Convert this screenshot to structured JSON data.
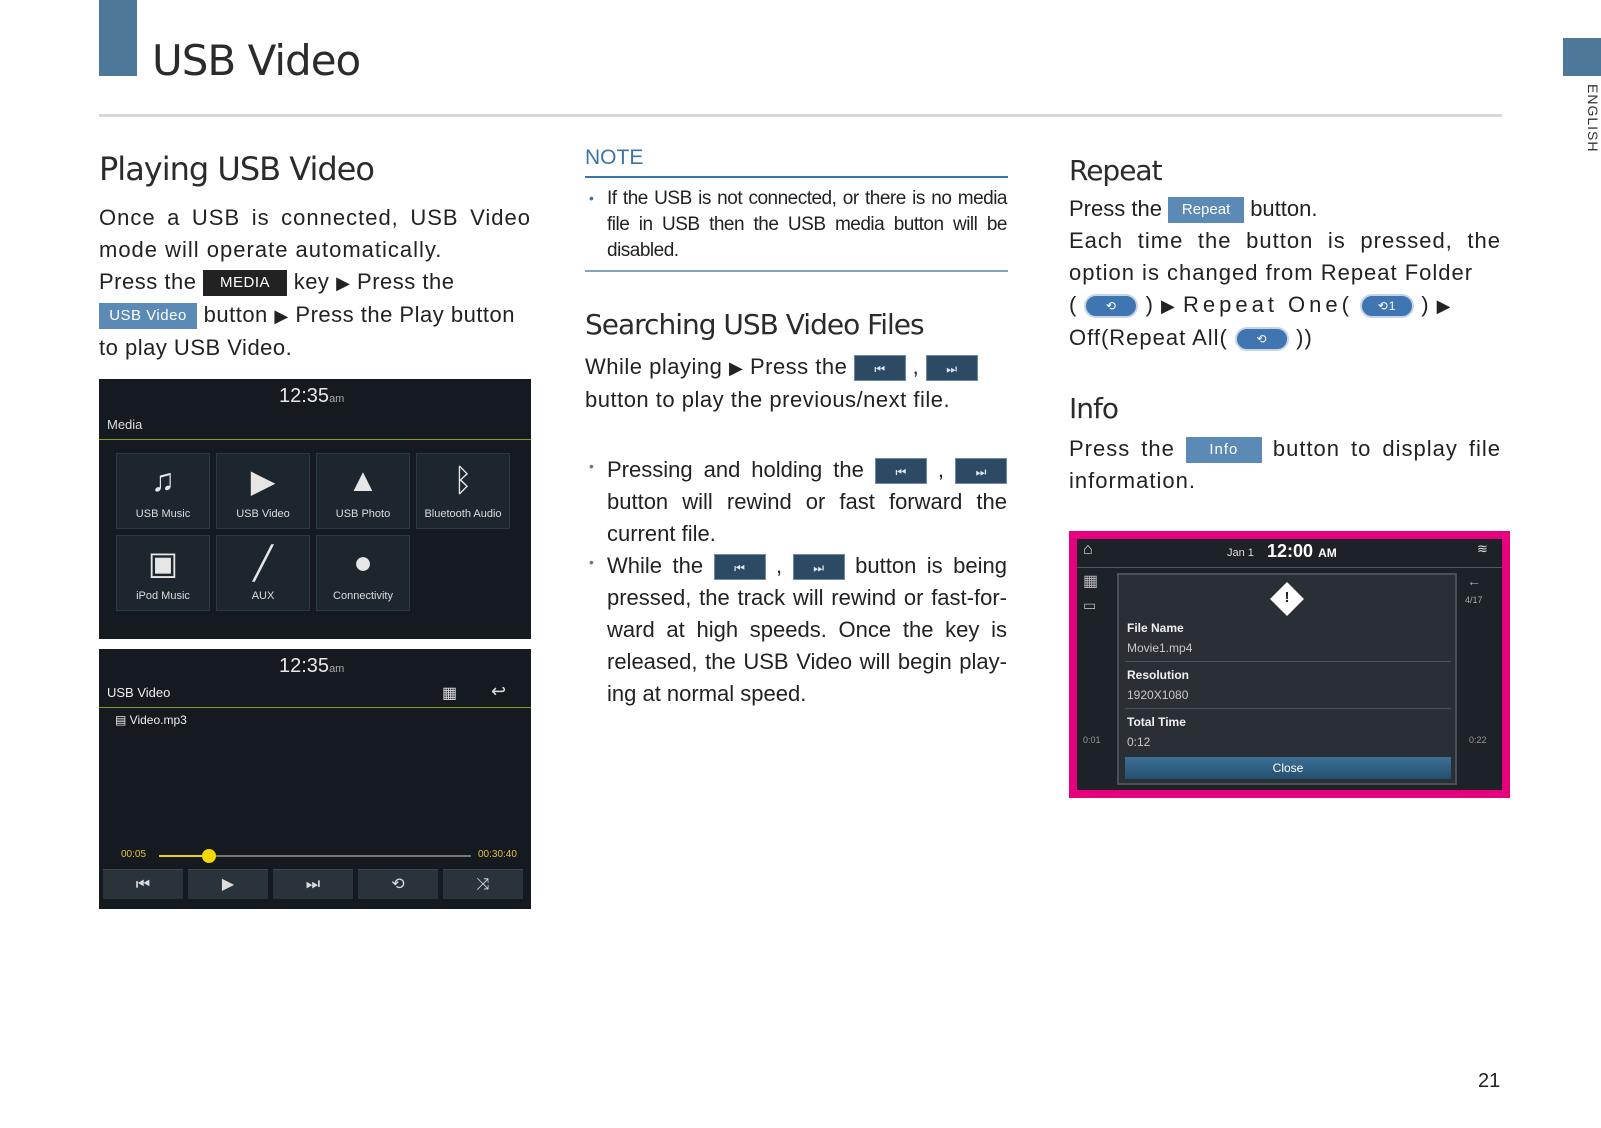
{
  "header": {
    "title": "USB Video",
    "language_tab": "ENGLISH",
    "page_number": "21"
  },
  "col1": {
    "heading": "Playing USB Video",
    "para1": "Once a USB is connected, USB Video mode will operate automatically.",
    "press_the_1": "Press the",
    "media_chip": "MEDIA",
    "key_text": "key",
    "press_the_2": "Press the",
    "usb_video_chip": "USB Video",
    "button_text": "button",
    "press_play": "Press the Play button",
    "to_play": "to play USB Video.",
    "screen1": {
      "time": "12:35",
      "ampm": "am",
      "title": "Media",
      "tiles": [
        {
          "label": "USB Music",
          "icon": "music-note-icon"
        },
        {
          "label": "USB Video",
          "icon": "video-icon"
        },
        {
          "label": "USB Photo",
          "icon": "photo-icon"
        },
        {
          "label": "Bluetooth Audio",
          "icon": "bluetooth-icon"
        },
        {
          "label": "iPod Music",
          "icon": "ipod-icon"
        },
        {
          "label": "AUX",
          "icon": "aux-plug-icon"
        },
        {
          "label": "Connectivity",
          "icon": "connectivity-icon"
        }
      ]
    },
    "screen2": {
      "time": "12:35",
      "ampm": "am",
      "title": "USB Video",
      "file": "Video.mp3",
      "elapsed": "00:05",
      "total": "00:30:40",
      "progress_fraction": 0.16
    }
  },
  "col2": {
    "note_title": "NOTE",
    "note_text": "If the USB is not connected, or there is no media file in USB then the USB media button will be disabled.",
    "heading": "Searching USB Video Files",
    "while_playing": "While playing",
    "press_the": "Press the",
    "comma": ",",
    "button_prev_next": "button to play the previous/next file.",
    "bullet1_a": "Pressing and holding the",
    "bullet1_b": "button will rewind or fast forward the current file.",
    "bullet2_a": "While the",
    "bullet2_b": "button is being pressed, the track will rewind or fast-for-ward at high speeds. Once the key is released, the USB Video will begin play-ing at normal speed."
  },
  "col3": {
    "repeat_heading": "Repeat",
    "press_the": "Press the",
    "repeat_chip": "Repeat",
    "button_dot": "button.",
    "repeat_para": "Each time the button is pressed, the option is changed from Repeat Folder",
    "repeat_one": "Repeat One(",
    "off_repeat_all": "Off(Repeat All(",
    "close_paren": "))",
    "info_heading": "Info",
    "info_press_the": "Press the",
    "info_chip": "Info",
    "info_button_text": "button to display file information.",
    "info_screen": {
      "date": "Jan 1",
      "time": "12:00",
      "ampm": "AM",
      "track_count": "4/17",
      "left_time": "0:01",
      "right_time": "0:22",
      "fields": [
        {
          "key": "File Name",
          "value": "Movie1.mp4"
        },
        {
          "key": "Resolution",
          "value": "1920X1080"
        },
        {
          "key": "Total Time",
          "value": "0:12"
        }
      ],
      "close_label": "Close"
    }
  },
  "colors": {
    "accent_blue": "#4d7899",
    "note_blue": "#3b74a6",
    "highlight_magenta": "#e6007e"
  }
}
